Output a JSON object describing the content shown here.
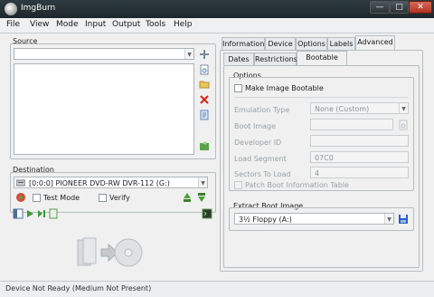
{
  "window": {
    "title": "ImgBurn",
    "min": "—",
    "max": "□",
    "close": "✕"
  },
  "menu": [
    "File",
    "View",
    "Mode",
    "Input",
    "Output",
    "Tools",
    "Help"
  ],
  "source": {
    "label": "Source",
    "value": ""
  },
  "destination": {
    "label": "Destination",
    "drive": "[0:0:0] PIONEER DVD-RW  DVR-112 (G:)",
    "test_mode": "Test Mode",
    "verify": "Verify"
  },
  "tabs_top": [
    "Information",
    "Device",
    "Options",
    "Labels",
    "Advanced"
  ],
  "tabs_sub": [
    "Dates",
    "Restrictions",
    "Bootable Disc"
  ],
  "options": {
    "label": "Options",
    "make_bootable": "Make Image Bootable",
    "emulation_type_label": "Emulation Type",
    "emulation_type_value": "None (Custom)",
    "boot_image_label": "Boot Image",
    "boot_image_value": "",
    "developer_id_label": "Developer ID",
    "developer_id_value": "",
    "load_segment_label": "Load Segment",
    "load_segment_value": "07C0",
    "sectors_to_load_label": "Sectors To Load",
    "sectors_to_load_value": "4",
    "patch_boot_info": "Patch Boot Information Table"
  },
  "extract": {
    "label": "Extract Boot Image",
    "value": "3½ Floppy (A:)"
  },
  "status": "Device Not Ready (Medium Not Present)",
  "colors": {
    "titlebar": "#1e282c",
    "close": "#c0392b",
    "accent": "#2a5fbf"
  }
}
